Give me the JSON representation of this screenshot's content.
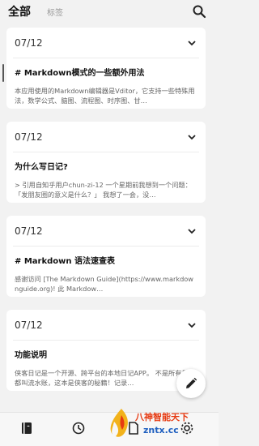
{
  "header": {
    "tab_all": "全部",
    "tab_tags": "标签",
    "search_icon": "search-icon"
  },
  "notes": [
    {
      "date": "07/12",
      "title": "# Markdown模式的一些额外用法",
      "excerpt": "本应用使用的Markdown编辑器是Vditor，它支持一些特殊用法，数学公式、脑图、流程图、时序图、甘…"
    },
    {
      "date": "07/12",
      "title": "为什么写日记?",
      "excerpt": "> 引用自知乎用户chun-zi-12 一个星期前我想到一个问题：「发朋友圈的意义是什么？」 我想了一会，没…"
    },
    {
      "date": "07/12",
      "title": "# Markdown 语法速查表",
      "excerpt": "感谢访问 [The Markdown Guide](https://www.markdownguide.org)! 此 Markdow…"
    },
    {
      "date": "07/12",
      "title": "功能说明",
      "excerpt": "侠客日记是一个开源、跨平台的本地日记APP。 不是所有日记都叫流水账，这本是侠客的秘籍！记录…"
    }
  ],
  "fab": {
    "icon": "edit-pencil-icon"
  },
  "bottom_nav": {
    "items": [
      "notebook-icon",
      "clock-icon",
      "document-icon",
      "settings-icon"
    ]
  },
  "watermark": {
    "line1": "八神智能天下",
    "line2": "zntx.cc"
  },
  "colors": {
    "background": "#f2f2f2",
    "card": "#ffffff",
    "watermark_red": "#e63a12",
    "watermark_blue": "#1f5fbf"
  }
}
